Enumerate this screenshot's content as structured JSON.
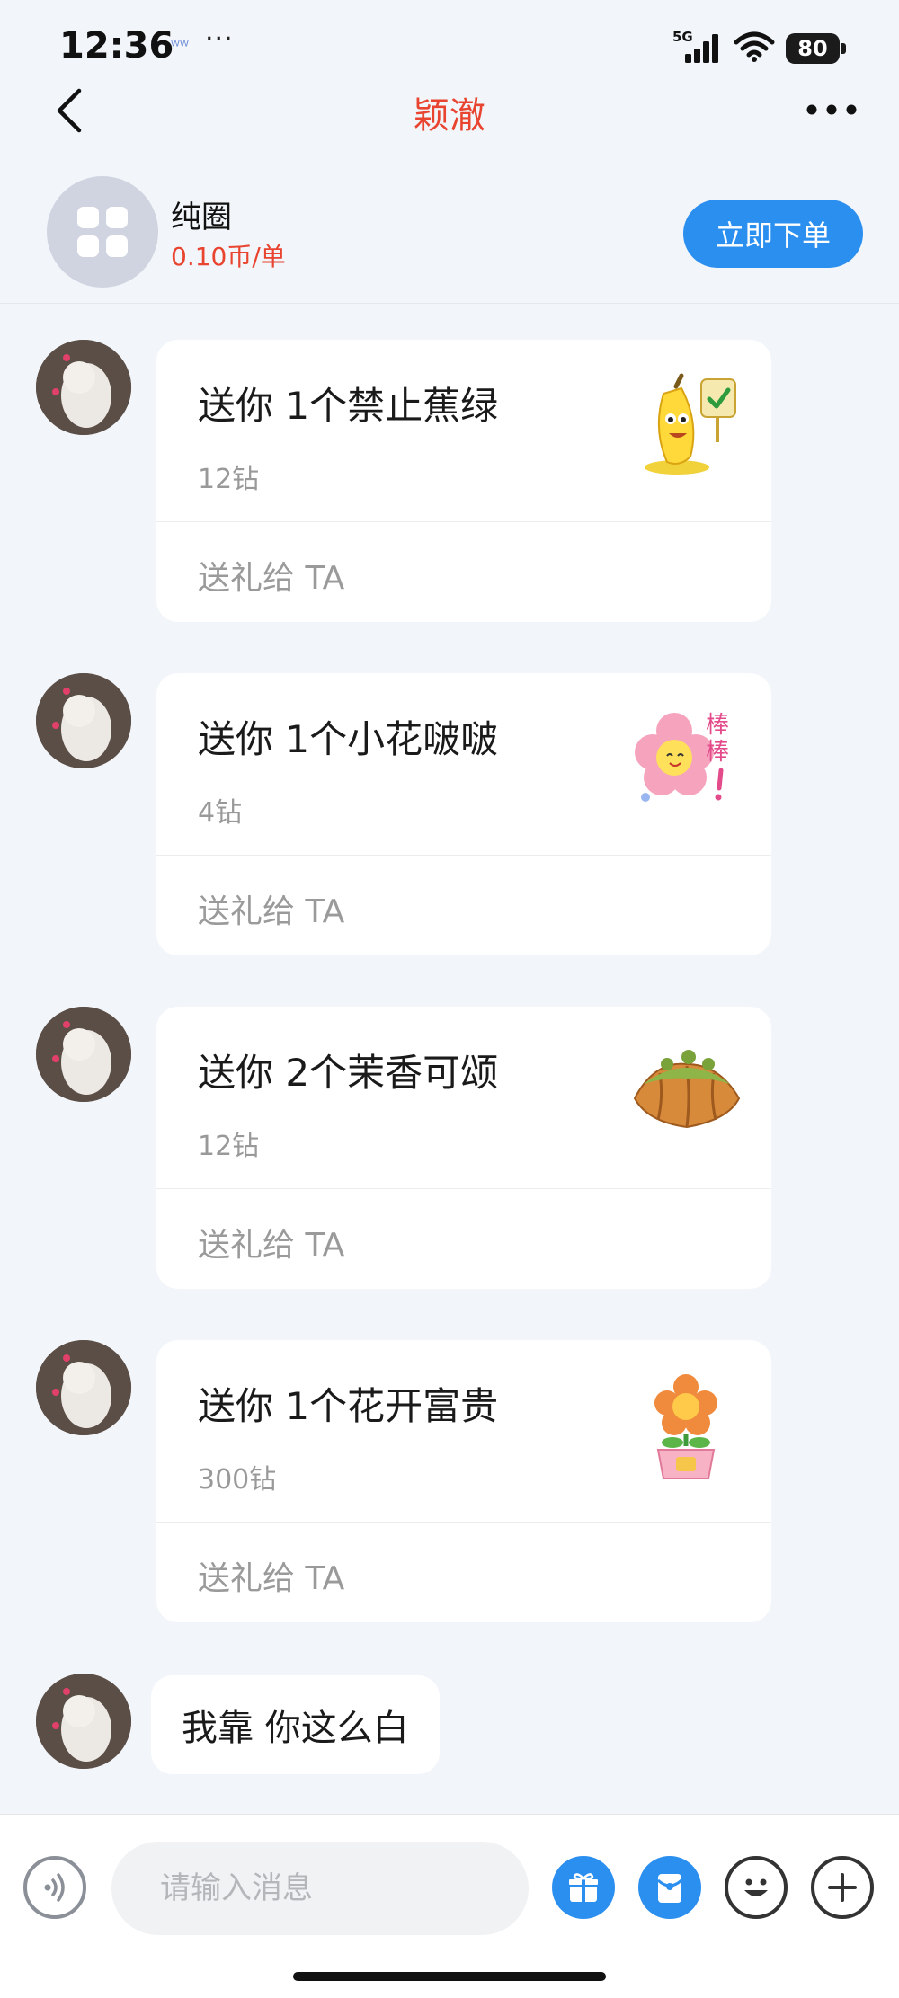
{
  "status_bar": {
    "time": "12:36",
    "notification": "ᵂᵂ",
    "dots": "···",
    "network": "5G",
    "battery": "80"
  },
  "nav": {
    "title": "颖澈"
  },
  "service": {
    "name": "纯圈",
    "price": "0.10币/单",
    "order_label": "立即下单"
  },
  "gifts": [
    {
      "title": "送你 1个禁止蕉绿",
      "price": "12钻",
      "action": "送礼给 TA",
      "icon": "banana-icon"
    },
    {
      "title": "送你 1个小花啵啵",
      "price": "4钻",
      "action": "送礼给 TA",
      "icon": "flower-icon"
    },
    {
      "title": "送你 2个茉香可颂",
      "price": "12钻",
      "action": "送礼给 TA",
      "icon": "croissant-icon"
    },
    {
      "title": "送你 1个花开富贵",
      "price": "300钻",
      "action": "送礼给 TA",
      "icon": "potted-flower-icon"
    }
  ],
  "last_message": "我靠 你这么白",
  "input": {
    "placeholder": "请输入消息"
  },
  "colors": {
    "accent": "#e8442f",
    "primary": "#2b8ff0",
    "background": "#f2f5f9"
  }
}
